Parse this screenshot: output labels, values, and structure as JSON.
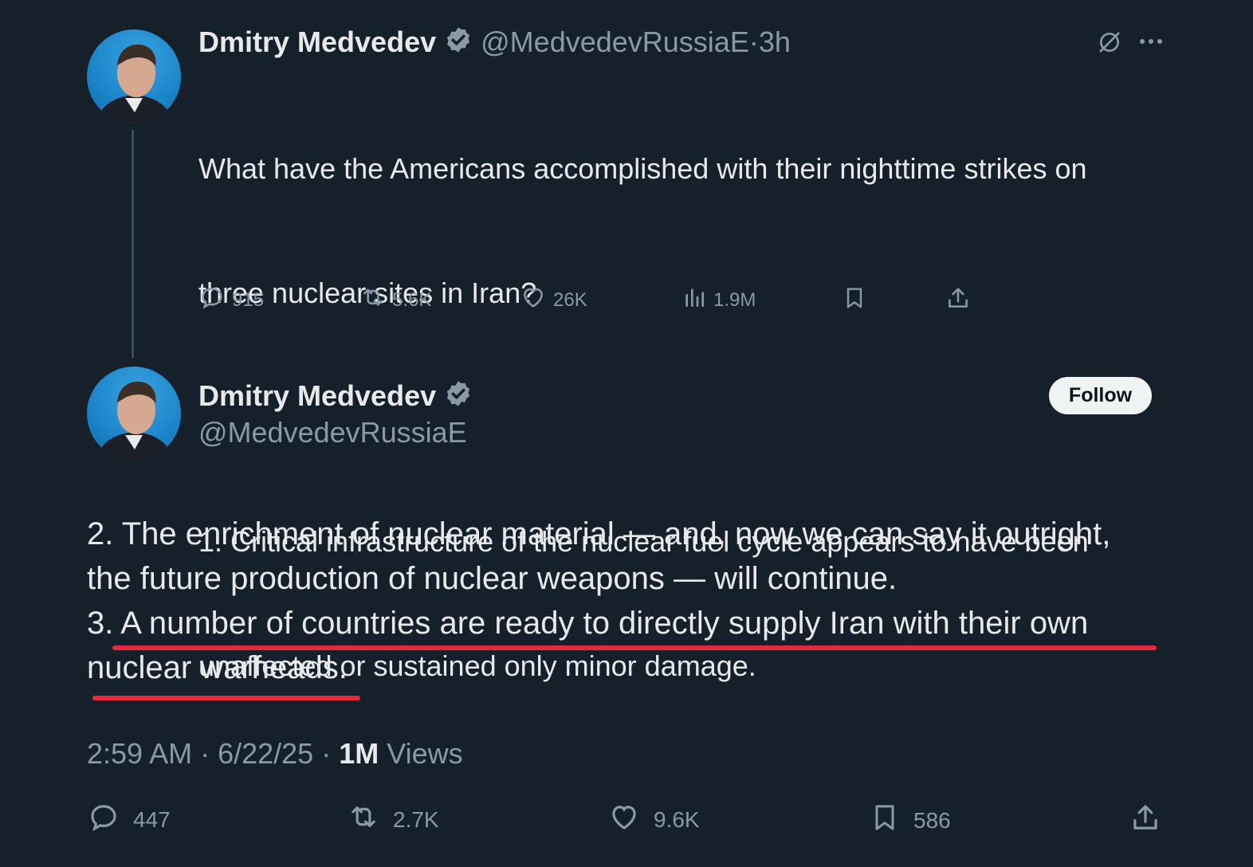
{
  "tweet1": {
    "author_name": "Dmitry Medvedev",
    "handle": "@MedvedevRussiaE",
    "separator": "·",
    "time_ago": "3h",
    "text_line1": "What have the Americans accomplished with their nighttime strikes on",
    "text_line2": "three nuclear sites in Iran?",
    "text_line3": "1. Critical infrastructure of the nuclear fuel cycle appears to have been",
    "text_line4": "unaffected or sustained only minor damage.",
    "stats": {
      "replies": "915",
      "reposts": "5.6K",
      "likes": "26K",
      "views": "1.9M"
    }
  },
  "tweet2": {
    "author_name": "Dmitry Medvedev",
    "handle": "@MedvedevRussiaE",
    "follow_label": "Follow",
    "line1": "2. The enrichment of nuclear material — and, now we can say it outright,",
    "line2": "the future production of nuclear weapons — will continue.",
    "line3": "3. A number of countries are ready to directly supply Iran with their own",
    "line4": "nuclear warheads.",
    "timestamp_time": "2:59 AM",
    "timestamp_sep1": " · ",
    "timestamp_date": "6/22/25",
    "timestamp_sep2": " · ",
    "views_count": "1M",
    "views_label": " Views",
    "stats": {
      "replies": "447",
      "reposts": "2.7K",
      "likes": "9.6K",
      "bookmarks": "586"
    }
  },
  "colors": {
    "background": "#15202b",
    "verified": "#8b98a5",
    "highlight": "#e8283b",
    "muted": "#8b98a5"
  },
  "icons": [
    "verified-badge-icon",
    "grok-icon",
    "more-icon",
    "reply-icon",
    "repost-icon",
    "like-icon",
    "views-icon",
    "bookmark-icon",
    "share-icon"
  ]
}
